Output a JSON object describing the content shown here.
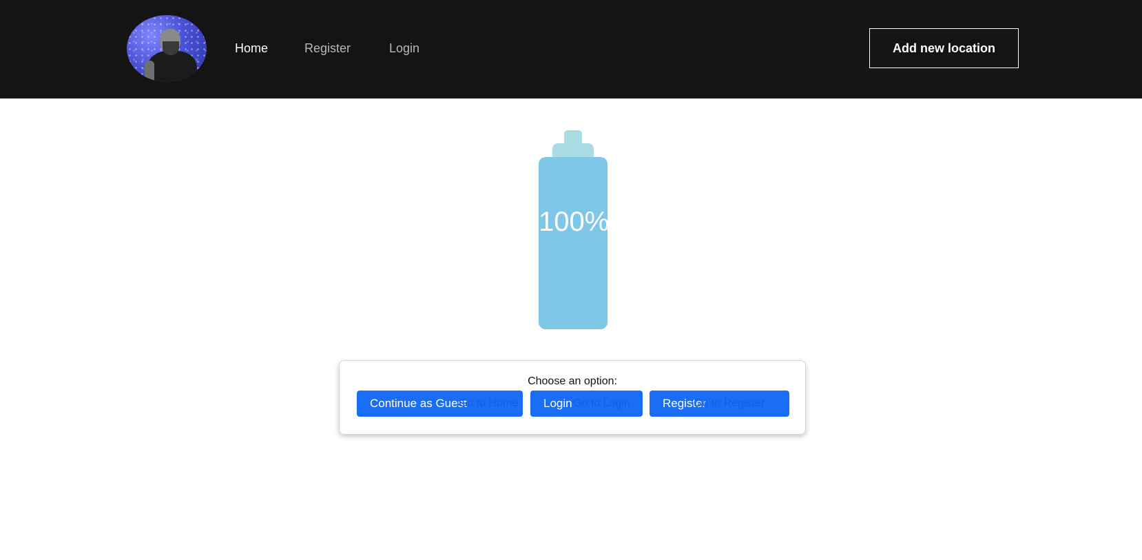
{
  "nav": {
    "avatar_alt": "",
    "links": [
      {
        "label": "Home",
        "active": true
      },
      {
        "label": "Register",
        "active": false
      },
      {
        "label": "Login",
        "active": false
      }
    ],
    "add_location_label": "Add new location"
  },
  "bottle": {
    "fill_percent": 100,
    "label": "100%",
    "colors": {
      "fill": "#7ec7e7",
      "cap": "#a9dde3"
    }
  },
  "options": {
    "prompt": "Choose an option:",
    "buttons": [
      {
        "label": "Continue as Guest",
        "hidden_label": "Go to Home"
      },
      {
        "label": "Login",
        "hidden_label": "Go to Login"
      },
      {
        "label": "Register",
        "hidden_label": "Go to Register"
      }
    ]
  },
  "colors": {
    "navbar": "#141414",
    "primary_button": "#1a6ef5"
  }
}
